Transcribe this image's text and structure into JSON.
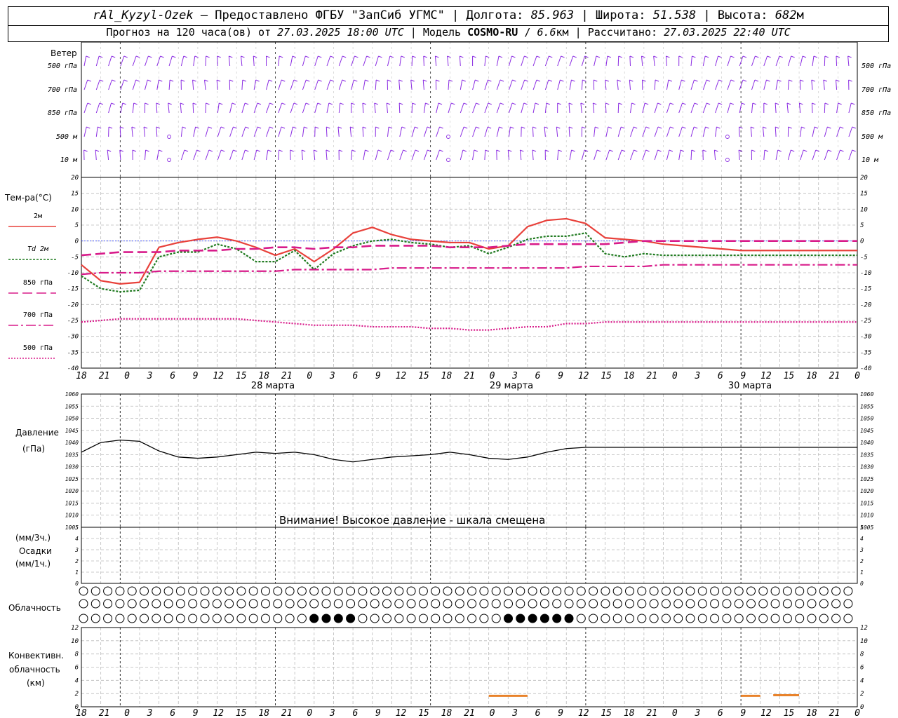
{
  "header": {
    "station": "rAl_Kyzyl-Ozek",
    "provider": "– Предоставлено ФГБУ \"ЗапСиб УГМС\"",
    "lon_label": "Долгота:",
    "lon": "85.963",
    "lat_label": "Широта:",
    "lat": "51.538",
    "alt_label": "Высота:",
    "alt": "682",
    "alt_unit": "м",
    "forecast_prefix": "Прогноз на 120 часа(ов) от",
    "forecast_time": "27.03.2025 18:00 UTC",
    "model_label": "Модель",
    "model_name": "COSMO-RU",
    "model_res": "6.6",
    "model_res_unit": "км",
    "calc_label": "Рассчитано:",
    "calc_time": "27.03.2025 22:40 UTC"
  },
  "labels": {
    "wind_title": "Ветер",
    "wind_levels": [
      "500 гПа",
      "700 гПа",
      "850 гПа",
      "500 м",
      "10  м"
    ],
    "temp_title": "Тем-ра(°С)",
    "temp_legend": [
      "2м",
      "Td  2м",
      "850 гПа",
      "700 гПа",
      "500 гПа"
    ],
    "pressure_title": "Давление",
    "pressure_unit": "(гПа)",
    "warning": "Внимание! Высокое давление - шкала смещена",
    "precip_unit3": "(мм/3ч.)",
    "precip_title": "Осадки",
    "precip_unit1": "(мм/1ч.)",
    "cloud_title": "Облачность",
    "conv_title1": "Конвективн.",
    "conv_title2": "облачность",
    "conv_unit": "(км)"
  },
  "colors": {
    "t2m": "#e8403a",
    "td2m": "#1f7a1f",
    "t850": "#d81b8a",
    "t700": "#d81b8a",
    "t500": "#d81b8a",
    "pressure": "#000000",
    "wind": "#8a2be2",
    "convective": "#e8822a",
    "zero_line": "#3344ff"
  },
  "chart_data": [
    {
      "type": "line",
      "title": "Тем-ра(°С)",
      "x_hours": [
        0,
        3,
        6,
        9,
        12,
        15,
        18,
        21,
        24,
        27,
        30,
        33,
        36,
        39,
        42,
        45,
        48,
        51,
        54,
        57,
        60,
        63,
        66,
        69,
        72,
        75,
        78,
        81,
        84,
        87,
        90,
        93,
        96,
        99,
        102,
        105,
        108,
        111,
        114,
        117,
        120
      ],
      "x_tick_labels": [
        "18",
        "21",
        "0",
        "3",
        "6",
        "9",
        "12",
        "15",
        "18",
        "21",
        "0",
        "3",
        "6",
        "9",
        "12",
        "15",
        "18",
        "21",
        "0",
        "3",
        "6",
        "9",
        "12",
        "15",
        "18",
        "21",
        "0",
        "3",
        "6",
        "9",
        "12",
        "15",
        "18",
        "21",
        "0"
      ],
      "date_labels": [
        "28 марта",
        "29 марта",
        "30 марта"
      ],
      "ylim": [
        -40,
        20
      ],
      "series": [
        {
          "name": "2м",
          "values": [
            -7.5,
            -12.5,
            -13.5,
            -13,
            -2,
            -0.5,
            0.5,
            1.2,
            0,
            -2,
            -4.5,
            -2.5,
            -6.5,
            -2.5,
            2.5,
            4.3,
            2,
            0.5,
            0,
            -0.5,
            -0.5,
            -2.5,
            -1.5,
            4.5,
            6.5,
            7,
            5.5,
            1,
            0.5,
            0,
            -1,
            -1.5,
            -2,
            -2.5,
            -3,
            -3,
            -3,
            -3,
            -3,
            -3,
            -3
          ]
        },
        {
          "name": "Td  2м",
          "values": [
            -11,
            -15,
            -16,
            -15.5,
            -5,
            -3.5,
            -3.5,
            -1,
            -2.5,
            -6.5,
            -6.5,
            -3,
            -9,
            -4,
            -1.5,
            0,
            0.5,
            -0.5,
            -1,
            -2,
            -1.5,
            -4,
            -2,
            0.5,
            1.5,
            1.5,
            2.5,
            -4,
            -5,
            -4,
            -4.5,
            -4.5,
            -4.5,
            -4.5,
            -4.5,
            -4.5,
            -4.5,
            -4.5,
            -4.5,
            -4.5,
            -4.5
          ]
        },
        {
          "name": "850 гПа",
          "values": [
            -4.5,
            -4,
            -3.5,
            -3.5,
            -3.5,
            -3,
            -3,
            -3,
            -2.5,
            -2.5,
            -2,
            -2,
            -2.5,
            -2,
            -2,
            -1.5,
            -1.5,
            -1.5,
            -1.5,
            -2,
            -2,
            -2,
            -1.5,
            -1,
            -1,
            -1,
            -1,
            -1,
            -0.5,
            0,
            0,
            0,
            0,
            0,
            0,
            0,
            0,
            0,
            0,
            0,
            0
          ]
        },
        {
          "name": "700 гПа",
          "values": [
            -10.5,
            -10,
            -10,
            -10,
            -9.5,
            -9.5,
            -9.5,
            -9.5,
            -9.5,
            -9.5,
            -9.5,
            -9,
            -9,
            -9,
            -9,
            -9,
            -8.5,
            -8.5,
            -8.5,
            -8.5,
            -8.5,
            -8.5,
            -8.5,
            -8.5,
            -8.5,
            -8.5,
            -8,
            -8,
            -8,
            -8,
            -7.5,
            -7.5,
            -7.5,
            -7.5,
            -7.5,
            -7.5,
            -7.5,
            -7.5,
            -7.5,
            -7.5,
            -7.5
          ]
        },
        {
          "name": "500 гПа",
          "values": [
            -25.5,
            -25,
            -24.5,
            -24.5,
            -24.5,
            -24.5,
            -24.5,
            -24.5,
            -24.5,
            -25,
            -25.5,
            -26,
            -26.5,
            -26.5,
            -26.5,
            -27,
            -27,
            -27,
            -27.5,
            -27.5,
            -28,
            -28,
            -27.5,
            -27,
            -27,
            -26,
            -26,
            -25.5,
            -25.5,
            -25.5,
            -25.5,
            -25.5,
            -25.5,
            -25.5,
            -25.5,
            -25.5,
            -25.5,
            -25.5,
            -25.5,
            -25.5,
            -25.5
          ]
        }
      ]
    },
    {
      "type": "line",
      "title": "Давление",
      "ylabel": "(гПа)",
      "ylim": [
        1005,
        1060
      ],
      "x_hours": [
        0,
        3,
        6,
        9,
        12,
        15,
        18,
        21,
        24,
        27,
        30,
        33,
        36,
        39,
        42,
        45,
        48,
        51,
        54,
        57,
        60,
        63,
        66,
        69,
        72,
        75,
        78,
        81,
        84,
        87,
        90,
        93,
        96,
        99,
        102,
        105,
        108,
        111,
        114,
        117,
        120
      ],
      "series": [
        {
          "name": "Давление",
          "values": [
            1036,
            1040,
            1041,
            1040.5,
            1036.5,
            1034,
            1033.5,
            1034,
            1035,
            1036,
            1035.5,
            1036,
            1035,
            1033,
            1032,
            1033,
            1034,
            1034.5,
            1035,
            1036,
            1035,
            1033.5,
            1033,
            1034,
            1036,
            1037.5,
            1038,
            1038,
            1038,
            1038,
            1038,
            1038,
            1038,
            1038,
            1038,
            1038,
            1038,
            1038,
            1038,
            1038,
            1038
          ]
        }
      ]
    },
    {
      "type": "bar",
      "title": "Осадки",
      "ylim": [
        0,
        5
      ],
      "values": []
    },
    {
      "type": "bar",
      "title": "Конвективн. облачность",
      "ylabel": "(км)",
      "ylim": [
        0,
        13
      ],
      "segments": [
        {
          "x_start": 63,
          "x_end": 69,
          "value": 1.8
        },
        {
          "x_start": 102,
          "x_end": 105,
          "value": 1.8
        },
        {
          "x_start": 107,
          "x_end": 111,
          "value": 1.9
        }
      ]
    }
  ]
}
